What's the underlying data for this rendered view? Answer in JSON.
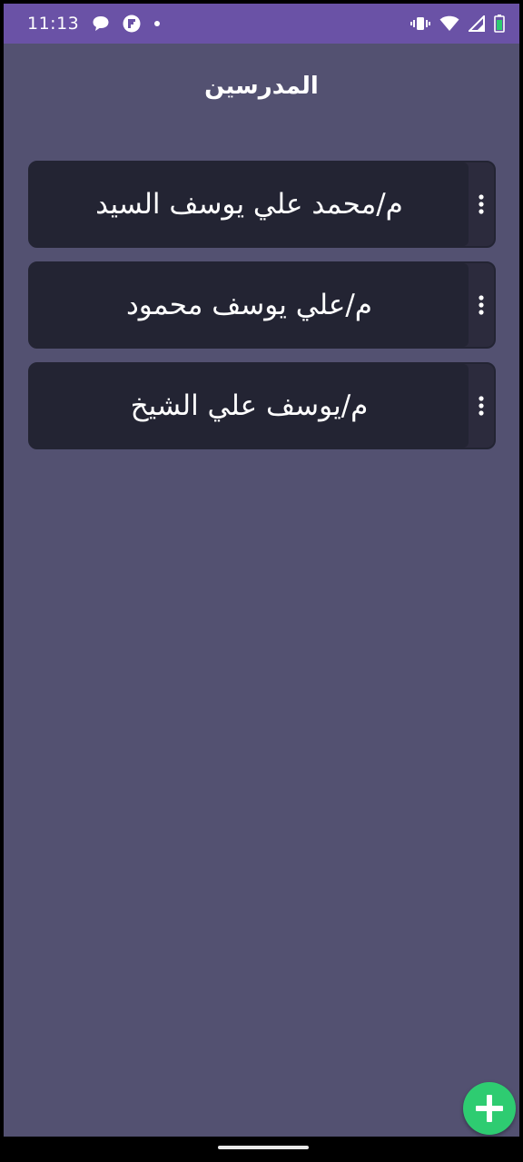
{
  "status_bar": {
    "time": "11:13",
    "left_icons": [
      "chat-bubble-icon",
      "flipboard-icon",
      "dot-icon"
    ],
    "right_icons": [
      "vibrate-icon",
      "wifi-icon",
      "signal-icon",
      "battery-icon"
    ],
    "color": "#6a52a6"
  },
  "header": {
    "title": "المدرسين"
  },
  "teachers": [
    {
      "name": "م/محمد علي يوسف السيد"
    },
    {
      "name": "م/علي يوسف محمود"
    },
    {
      "name": "م/يوسف علي الشيخ"
    }
  ],
  "fab": {
    "icon": "plus-icon",
    "color": "#2ecc71"
  },
  "colors": {
    "background": "#535171",
    "card": "#232433"
  }
}
